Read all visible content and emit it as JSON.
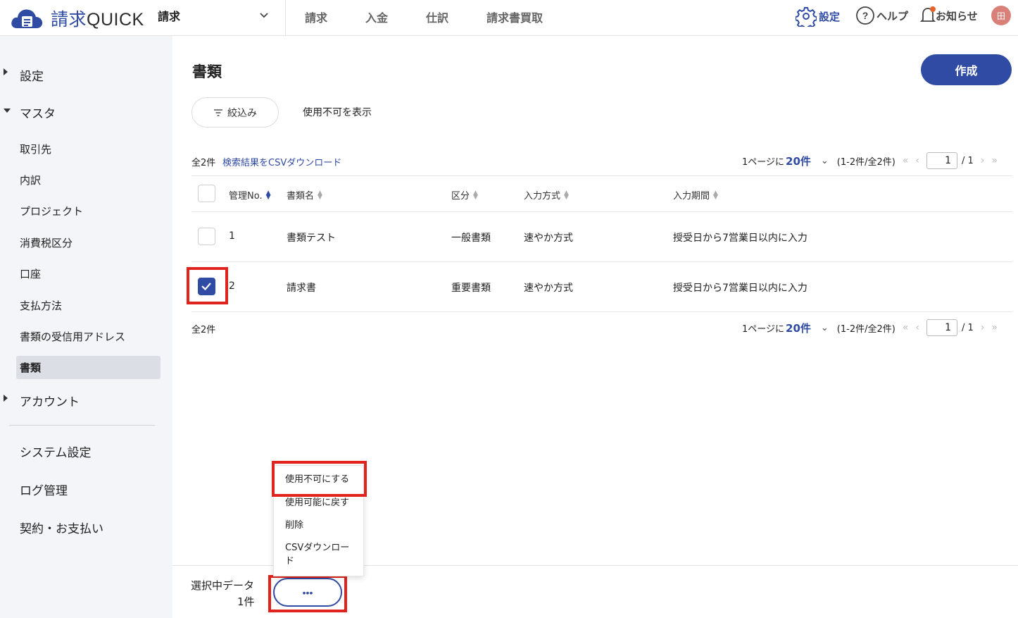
{
  "header": {
    "brand_jp": "請求",
    "brand_en": "QUICK",
    "app_selector": "請求",
    "nav": [
      "請求",
      "入金",
      "仕訳",
      "請求書買取"
    ],
    "settings": "設定",
    "help": "ヘルプ",
    "notices": "お知らせ",
    "avatar": "田"
  },
  "sidebar": {
    "settings": "設定",
    "master": "マスタ",
    "master_items": [
      "取引先",
      "内訳",
      "プロジェクト",
      "消費税区分",
      "口座",
      "支払方法",
      "書類の受信用アドレス"
    ],
    "active_item": "書類",
    "account": "アカウント",
    "system_settings": "システム設定",
    "log_management": "ログ管理",
    "contract": "契約・お支払い"
  },
  "main": {
    "title": "書類",
    "create_button": "作成",
    "filter_button": "絞込み",
    "show_disabled": "使用不可を表示",
    "total_count": "全2件",
    "csv_download": "検索結果をCSVダウンロード",
    "pager": {
      "per_page_prefix": "1ページに",
      "per_page": "20件",
      "range": "(1-2件/全2件)",
      "current_page": "1",
      "total_pages": "/ 1"
    },
    "table": {
      "headers": [
        "管理No.",
        "書類名",
        "区分",
        "入力方式",
        "入力期間"
      ],
      "rows": [
        {
          "no": "1",
          "name": "書類テスト",
          "category": "一般書類",
          "method": "速やか方式",
          "period": "授受日から7営業日以内に入力",
          "checked": false
        },
        {
          "no": "2",
          "name": "請求書",
          "category": "重要書類",
          "method": "速やか方式",
          "period": "授受日から7営業日以内に入力",
          "checked": true
        }
      ]
    }
  },
  "bottom_bar": {
    "selected_label": "選択中データ",
    "selected_count": "1件",
    "more_button": "•••"
  },
  "context_menu": {
    "items": [
      "使用不可にする",
      "使用可能に戻す",
      "削除",
      "CSVダウンロー",
      "ド"
    ]
  },
  "colors": {
    "accent": "#2f4ba3",
    "highlight": "#e0231c",
    "sidebar_bg": "#f4f5f8"
  }
}
